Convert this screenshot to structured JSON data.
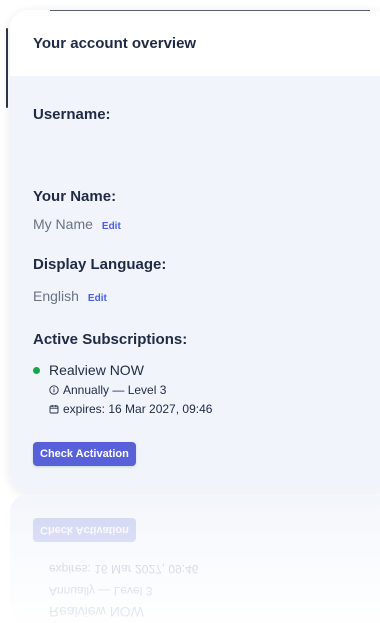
{
  "card": {
    "title": "Your account overview"
  },
  "fields": {
    "username_label": "Username:",
    "name_label": "Your Name:",
    "name_value": "My Name",
    "name_edit": "Edit",
    "language_label": "Display Language:",
    "language_value": "English",
    "language_edit": "Edit",
    "subscriptions_label": "Active Subscriptions:"
  },
  "subscriptions": [
    {
      "name": "Realview NOW",
      "plan": "Annually — Level 3",
      "expires": "expires: 16 Mar 2027, 09:46",
      "status_color": "#1aa54a"
    }
  ],
  "actions": {
    "check_activation": "Check Activation"
  },
  "colors": {
    "accent": "#5861d8",
    "link": "#4a5fd6",
    "heading": "#1f2a44",
    "card_bg": "#f1f5fb",
    "status_active": "#1aa54a"
  },
  "icons": {
    "plan_icon": "info-circle-icon",
    "expires_icon": "calendar-icon",
    "status_icon": "status-dot-icon"
  }
}
